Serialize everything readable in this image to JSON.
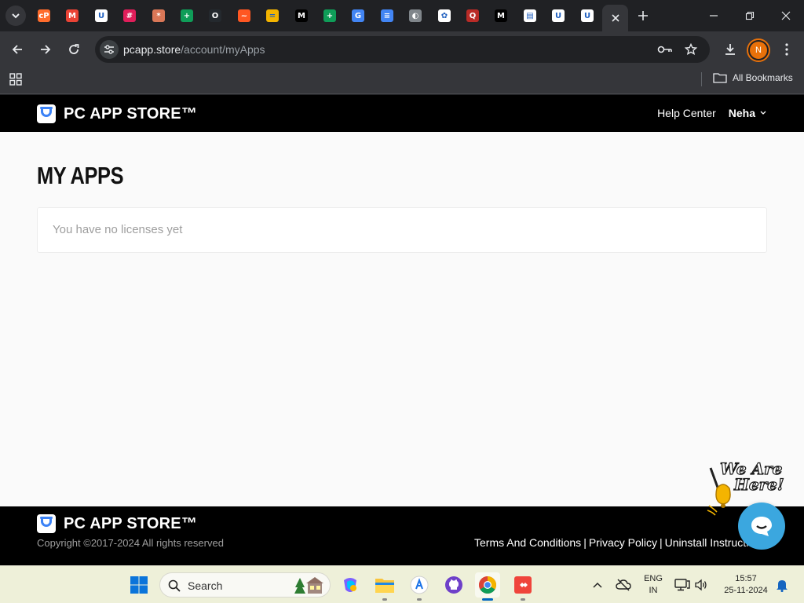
{
  "browser": {
    "tabs": [
      {
        "icon": "cpanel-icon",
        "color": "#ff6c2c"
      },
      {
        "icon": "gmail-icon",
        "color": "#ea4335"
      },
      {
        "icon": "pcappstore-icon",
        "color": "#ffffff"
      },
      {
        "icon": "slack-icon",
        "color": "#e01e5a"
      },
      {
        "icon": "claude-icon",
        "color": "#d97757"
      },
      {
        "icon": "sheets-icon",
        "color": "#0f9d58"
      },
      {
        "icon": "github-icon",
        "color": "#24292e"
      },
      {
        "icon": "fire-icon",
        "color": "#ff5722"
      },
      {
        "icon": "classroom-icon",
        "color": "#f4b400"
      },
      {
        "icon": "medium-icon",
        "color": "#000000"
      },
      {
        "icon": "sheets-icon",
        "color": "#0f9d58"
      },
      {
        "icon": "google-icon",
        "color": "#4285f4"
      },
      {
        "icon": "docs-icon",
        "color": "#4285f4"
      },
      {
        "icon": "globe-icon",
        "color": "#80868b"
      },
      {
        "icon": "chatgpt-icon",
        "color": "#ffffff"
      },
      {
        "icon": "quora-icon",
        "color": "#b92b27"
      },
      {
        "icon": "medium-icon",
        "color": "#000000"
      },
      {
        "icon": "image-icon",
        "color": "#ffffff"
      },
      {
        "icon": "pcappstore-icon",
        "color": "#ffffff"
      },
      {
        "icon": "pcappstore-icon",
        "color": "#ffffff"
      }
    ],
    "url_domain": "pcapp.store",
    "url_path": "/account/myApps",
    "bookmarks_label": "All Bookmarks",
    "profile_initial": "N"
  },
  "site": {
    "brand": "PC APP STORE™",
    "help_center": "Help Center",
    "user_name": "Neha",
    "page_title": "MY APPS",
    "empty_message": "You have no licenses yet",
    "footer_brand": "PC APP STORE™",
    "copyright": "Copyright ©2017-2024 All rights reserved",
    "footer_links": [
      "Terms And Conditions",
      "Privacy Policy",
      "Uninstall Instructions"
    ]
  },
  "taskbar": {
    "search_label": "Search",
    "lang_line1": "ENG",
    "lang_line2": "IN",
    "time": "15:57",
    "date": "25-11-2024"
  },
  "colors": {
    "chrome_dark": "#202124",
    "chrome_toolbar": "#35363a",
    "site_header": "#000000",
    "chat_accent": "#3ba7df",
    "taskbar_bg": "#eef0d9"
  }
}
